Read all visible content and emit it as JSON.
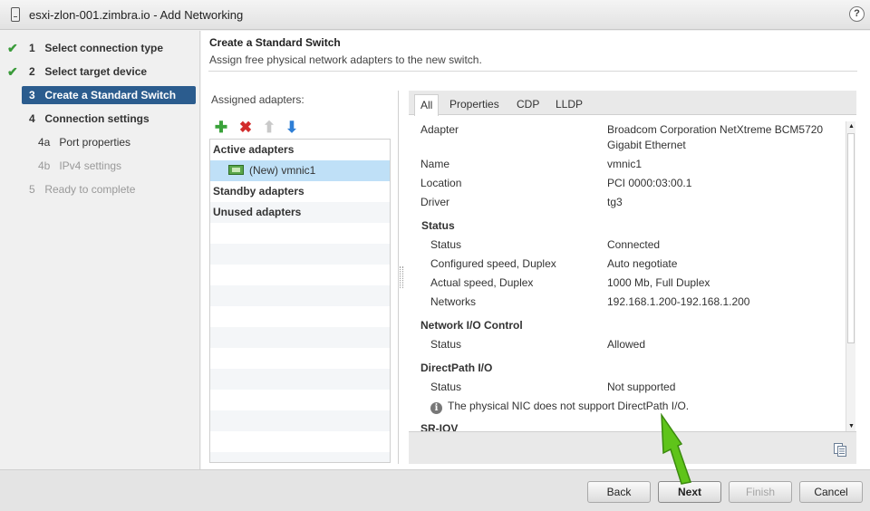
{
  "window": {
    "title": "esxi-zlon-001.zimbra.io - Add Networking",
    "help_icon": "help-icon",
    "help_glyph": "?"
  },
  "steps": [
    {
      "num": "1",
      "label": "Select connection type",
      "done": true
    },
    {
      "num": "2",
      "label": "Select target device",
      "done": true
    },
    {
      "num": "3",
      "label": "Create a Standard Switch",
      "active": true
    },
    {
      "num": "4",
      "label": "Connection settings"
    },
    {
      "num": "4a",
      "label": "Port properties"
    },
    {
      "num": "4b",
      "label": "IPv4 settings",
      "disabled": true
    },
    {
      "num": "5",
      "label": "Ready to complete",
      "disabled": true
    }
  ],
  "page": {
    "title": "Create a Standard Switch",
    "subtitle": "Assign free physical network adapters to the new switch."
  },
  "adapters": {
    "label": "Assigned adapters:",
    "toolbar": [
      {
        "icon": "add-icon",
        "glyph": "✚"
      },
      {
        "icon": "remove-icon",
        "glyph": "✖"
      },
      {
        "icon": "move-up-icon",
        "glyph": "⬆"
      },
      {
        "icon": "move-down-icon",
        "glyph": "⬇"
      }
    ],
    "active_group": "Active adapters",
    "selected_adapter": "(New) vmnic1",
    "standby_group": "Standby adapters",
    "unused_group": "Unused adapters"
  },
  "tabs": [
    "All",
    "Properties",
    "CDP",
    "LLDP"
  ],
  "details": {
    "adapter_label": "Adapter",
    "adapter_value_1": "Broadcom Corporation NetXtreme BCM5720",
    "adapter_value_2": "Gigabit Ethernet",
    "name_label": "Name",
    "name_value": "vmnic1",
    "location_label": "Location",
    "location_value": "PCI 0000:03:00.1",
    "driver_label": "Driver",
    "driver_value": "tg3",
    "status_section": "Status",
    "status_label": "Status",
    "status_value": "Connected",
    "conf_speed_label": "Configured speed, Duplex",
    "conf_speed_value": "Auto negotiate",
    "actual_speed_label": "Actual speed, Duplex",
    "actual_speed_value": "1000 Mb, Full Duplex",
    "networks_label": "Networks",
    "networks_value": "192.168.1.200-192.168.1.200",
    "nioc_section": "Network I/O Control",
    "nioc_status_label": "Status",
    "nioc_status_value": "Allowed",
    "directpath_section": "DirectPath I/O",
    "dp_status_label": "Status",
    "dp_status_value": "Not supported",
    "dp_note": "The physical NIC does not support DirectPath I/O.",
    "sriov_section": "SR-IOV"
  },
  "buttons": {
    "back": "Back",
    "next": "Next",
    "finish": "Finish",
    "cancel": "Cancel"
  },
  "colors": {
    "active_step": "#2b5c8e",
    "selection": "#bfe0f7",
    "check": "#3a9b3a",
    "pointer": "#5fc41a"
  }
}
